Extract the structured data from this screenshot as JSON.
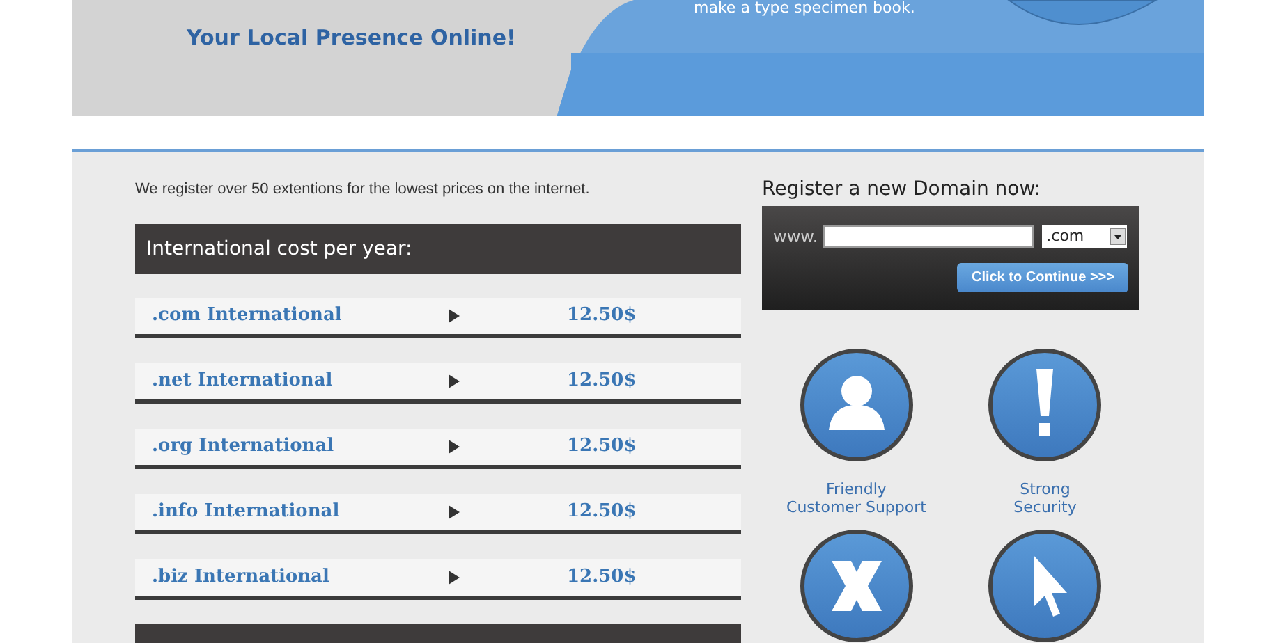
{
  "header": {
    "tagline": "Your Local Presence Online!",
    "caption": "make a type specimen book."
  },
  "intro": "We register over 50 extentions for the lowest prices on the internet.",
  "price_table": {
    "title": "International cost per year:",
    "rows": [
      {
        "name": ".com International",
        "price": "12.50$"
      },
      {
        "name": ".net International",
        "price": "12.50$"
      },
      {
        "name": ".org International",
        "price": "12.50$"
      },
      {
        "name": ".info International",
        "price": "12.50$"
      },
      {
        "name": ".biz International",
        "price": "12.50$"
      }
    ]
  },
  "domain_form": {
    "title": "Register a new Domain now:",
    "prefix": "www.",
    "extension": ".com",
    "button": "Click to Continue >>>"
  },
  "features": [
    {
      "kind": "person",
      "label": "Friendly\nCustomer Support"
    },
    {
      "kind": "exclamation",
      "label": "Strong\nSecurity"
    },
    {
      "kind": "x"
    },
    {
      "kind": "cursor"
    }
  ]
}
